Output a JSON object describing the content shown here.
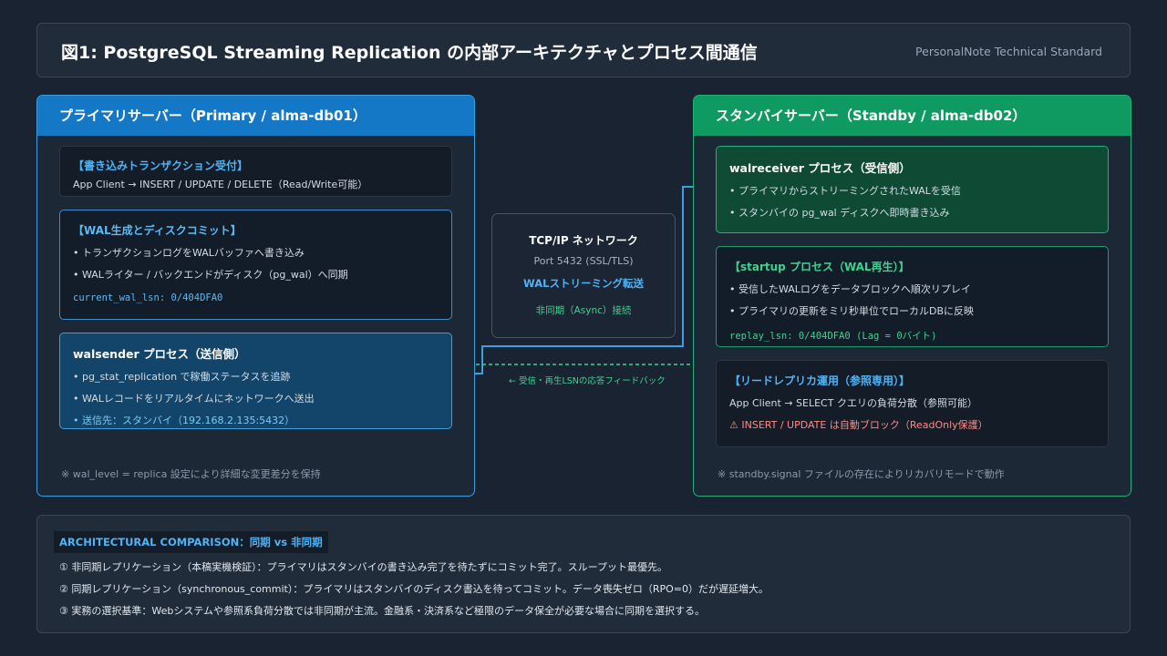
{
  "header": {
    "title": "図1: PostgreSQL Streaming Replication の内部アーキテクチャとプロセス間通信",
    "brand": "PersonalNote Technical Standard"
  },
  "primary": {
    "title": "プライマリサーバー（Primary / alma-db01）",
    "tx_box": {
      "title": "【書き込みトランザクション受付】",
      "line": "App Client → INSERT / UPDATE / DELETE（Read/Write可能）"
    },
    "wal_box": {
      "title": "【WAL生成とディスクコミット】",
      "lines": [
        "• トランザクションログをWALバッファへ書き込み",
        "• WALライター / バックエンドがディスク（pg_wal）へ同期"
      ],
      "code": "current_wal_lsn: 0/404DFA0"
    },
    "sender_box": {
      "title": "walsender プロセス（送信側）",
      "lines": [
        "• pg_stat_replication で稼働ステータスを追跡",
        "• WALレコードをリアルタイムにネットワークへ送出",
        "• 送信先：スタンバイ（192.168.2.135:5432）"
      ]
    },
    "footnote": "※ wal_level = replica 設定により詳細な変更差分を保持"
  },
  "standby": {
    "title": "スタンバイサーバー（Standby / alma-db02）",
    "receiver_box": {
      "title": "walreceiver プロセス（受信側）",
      "lines": [
        "• プライマリからストリーミングされたWALを受信",
        "• スタンバイの pg_wal ディスクへ即時書き込み"
      ]
    },
    "startup_box": {
      "title": "【startup プロセス（WAL再生）】",
      "lines": [
        "• 受信したWALログをデータブロックへ順次リプレイ",
        "• プライマリの更新をミリ秒単位でローカルDBに反映"
      ],
      "code": "replay_lsn: 0/404DFA0 (Lag = 0バイト)"
    },
    "replica_box": {
      "title": "【リードレプリカ運用（参照専用）】",
      "line": "App Client → SELECT クエリの負荷分散（参照可能）",
      "warn": "⚠ INSERT / UPDATE は自動ブロック（ReadOnly保護）"
    },
    "footnote": "※ standby.signal ファイルの存在によりリカバリモードで動作"
  },
  "network": {
    "title": "TCP/IP ネットワーク",
    "port": "Port 5432 (SSL/TLS)",
    "stream": "WALストリーミング転送",
    "mode": "非同期（Async）接続",
    "feedback": "← 受信・再生LSNの応答フィードバック"
  },
  "comparison": {
    "title": "ARCHITECTURAL COMPARISON：同期 vs 非同期",
    "items": [
      "① 非同期レプリケーション（本稿実機検証）：プライマリはスタンバイの書き込み完了を待たずにコミット完了。スループット最優先。",
      "② 同期レプリケーション（synchronous_commit）：プライマリはスタンバイのディスク書込を待ってコミット。データ喪失ゼロ（RPO=0）だが遅延増大。",
      "③ 実務の選択基準：Webシステムや参照系負荷分散では非同期が主流。金融系・決済系など極限のデータ保全が必要な場合に同期を選択する。"
    ]
  },
  "colors": {
    "primary_accent": "#1478c6",
    "standby_accent": "#0f9a62",
    "stream_line": "#3aa0e0",
    "feedback_line": "#3fd28f",
    "warning": "#ff8a85"
  }
}
